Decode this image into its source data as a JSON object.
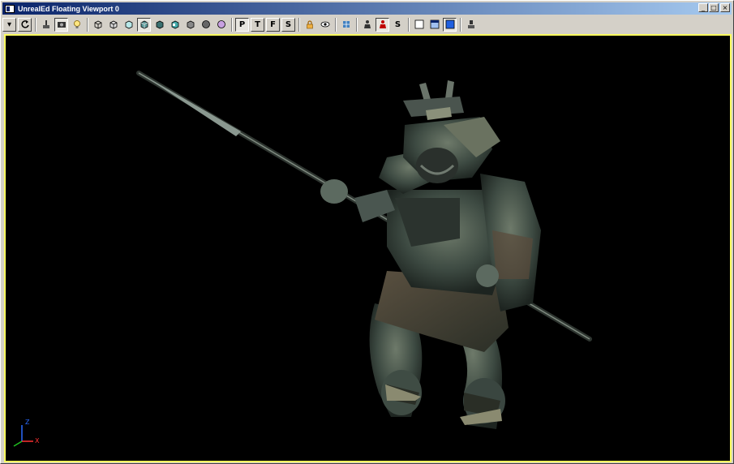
{
  "window": {
    "title": "UnrealEd Floating Viewport 0",
    "controls": {
      "minimize": "_",
      "maximize": "□",
      "close": "×"
    }
  },
  "toolbar": {
    "menu_arrow": "▾",
    "letter_buttons": [
      "P",
      "T",
      "F",
      "S"
    ],
    "s_label": "S",
    "icons": [
      "viewport-menu-icon",
      "refresh-icon",
      "actor-icon",
      "camera-icon",
      "light-icon",
      "wireframe-icon",
      "bsp-icon",
      "unlit-icon",
      "textured-icon",
      "lighting-icon",
      "zone-icon",
      "polys-icon",
      "depth-icon",
      "lock-icon",
      "eye-icon",
      "brush-icon",
      "actor-mode-icon",
      "actor-selected-icon",
      "layout-single-icon",
      "layout-split-icon",
      "layout-quad-icon",
      "statue-icon"
    ]
  },
  "viewport": {
    "border_color": "#ffff60",
    "background": "#000000",
    "axis": {
      "z": "Z",
      "x": "X"
    },
    "axis_colors": {
      "z": "#2a6bff",
      "x": "#ff3030",
      "y": "#20c020"
    },
    "scene": "armored-samurai-spear-mesh"
  }
}
